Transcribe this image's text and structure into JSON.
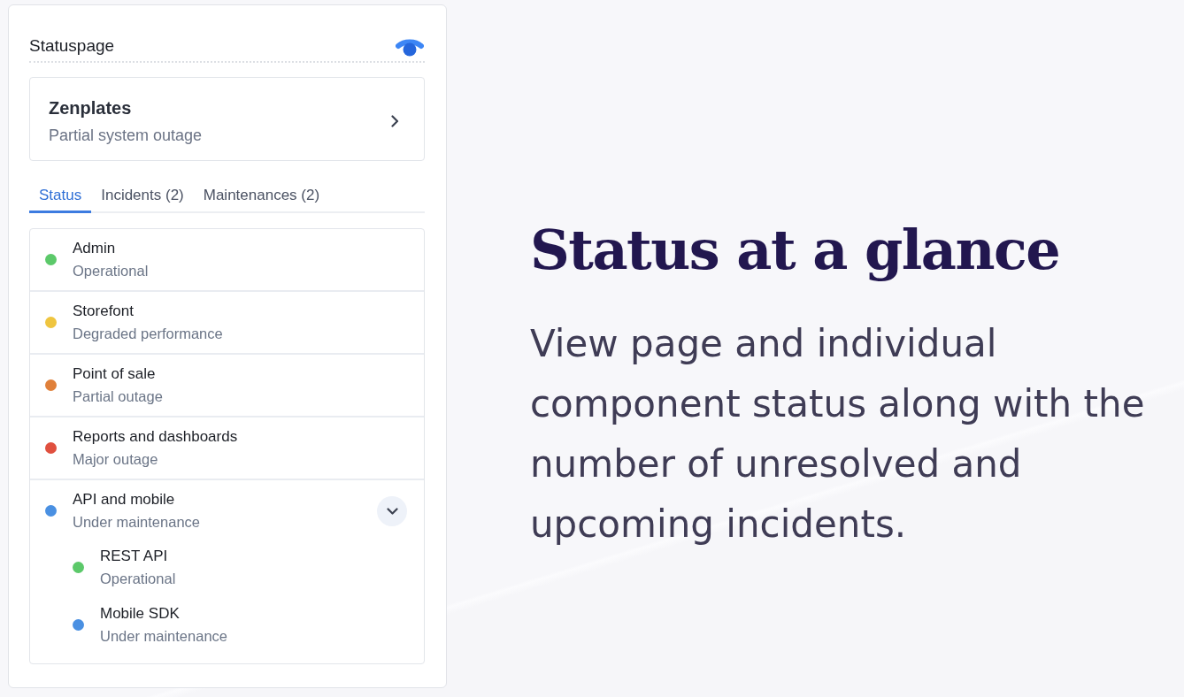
{
  "panel": {
    "title": "Statuspage"
  },
  "page_summary": {
    "name": "Zenplates",
    "status": "Partial system outage"
  },
  "tabs": [
    {
      "label": "Status",
      "selected": true
    },
    {
      "label": "Incidents (2)",
      "selected": false
    },
    {
      "label": "Maintenances (2)",
      "selected": false
    }
  ],
  "components": [
    {
      "name": "Admin",
      "status": "Operational",
      "color": "#5cc96a"
    },
    {
      "name": "Storefont",
      "status": "Degraded performance",
      "color": "#efc53f"
    },
    {
      "name": "Point of sale",
      "status": "Partial outage",
      "color": "#e0803a"
    },
    {
      "name": "Reports and dashboards",
      "status": "Major outage",
      "color": "#e0503f"
    },
    {
      "name": "API and mobile",
      "status": "Under maintenance",
      "color": "#4a90e2",
      "expanded": true,
      "children": [
        {
          "name": "REST API",
          "status": "Operational",
          "color": "#5cc96a"
        },
        {
          "name": "Mobile SDK",
          "status": "Under maintenance",
          "color": "#4a90e2"
        }
      ]
    }
  ],
  "feature": {
    "heading": "Status at a glance",
    "description": "View page and individual component status along with the number of unresolved and upcoming incidents."
  }
}
